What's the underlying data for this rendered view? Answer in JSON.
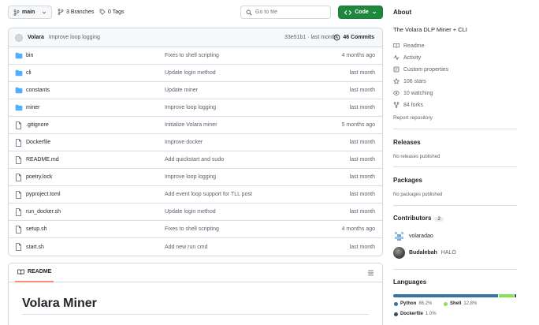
{
  "toolbar": {
    "branch": "main",
    "branches": "3 Branches",
    "tags": "0 Tags",
    "goto_placeholder": "Go to file",
    "code_label": "Code"
  },
  "commit": {
    "author": "Volara",
    "message": "Improve loop logging",
    "hash_time": "33e51b1 · last month",
    "commits": "46 Commits"
  },
  "files": [
    {
      "name": "bin",
      "type": "dir",
      "msg": "Fixes to shell scripting",
      "time": "4 months ago"
    },
    {
      "name": "cli",
      "type": "dir",
      "msg": "Update login method",
      "time": "last month"
    },
    {
      "name": "constants",
      "type": "dir",
      "msg": "Update miner",
      "time": "last month"
    },
    {
      "name": "miner",
      "type": "dir",
      "msg": "Improve loop logging",
      "time": "last month"
    },
    {
      "name": ".gitignore",
      "type": "file",
      "msg": "Initialize Volara miner",
      "time": "5 months ago"
    },
    {
      "name": "Dockerfile",
      "type": "file",
      "msg": "Improve docker",
      "time": "last month"
    },
    {
      "name": "README.md",
      "type": "file",
      "msg": "Add quickstart and sudo",
      "time": "last month"
    },
    {
      "name": "poetry.lock",
      "type": "file",
      "msg": "Improve loop logging",
      "time": "last month"
    },
    {
      "name": "pyproject.toml",
      "type": "file",
      "msg": "Add event loop support for TLL post",
      "time": "last month"
    },
    {
      "name": "run_docker.sh",
      "type": "file",
      "msg": "Update login method",
      "time": "last month"
    },
    {
      "name": "setup.sh",
      "type": "file",
      "msg": "Fixes to shell scripting",
      "time": "4 months ago"
    },
    {
      "name": "start.sh",
      "type": "file",
      "msg": "Add new run cmd",
      "time": "last month"
    }
  ],
  "readme": {
    "tab_label": "README",
    "title": "Volara Miner"
  },
  "about": {
    "heading": "About",
    "description": "The Volara DLP Miner + CLI",
    "readme": "Readme",
    "activity": "Activity",
    "custom_properties": "Custom properties",
    "stars": "106 stars",
    "watching": "10 watching",
    "forks": "84 forks",
    "report": "Report repository"
  },
  "releases": {
    "heading": "Releases",
    "empty": "No releases published"
  },
  "packages": {
    "heading": "Packages",
    "empty": "No packages published"
  },
  "contributors": {
    "heading": "Contributors",
    "count": "2",
    "people": [
      {
        "name": "volaradao",
        "extra": ""
      },
      {
        "name": "Budalebah",
        "extra": "HALO"
      }
    ]
  },
  "languages": {
    "heading": "Languages",
    "items": [
      {
        "name": "Python",
        "pct": "86.2%",
        "percent": 86.2,
        "color": "#3572A5"
      },
      {
        "name": "Shell",
        "pct": "12.8%",
        "percent": 12.8,
        "color": "#89e051"
      },
      {
        "name": "Dockerfile",
        "pct": "1.0%",
        "percent": 1.0,
        "color": "#384d54"
      }
    ]
  }
}
